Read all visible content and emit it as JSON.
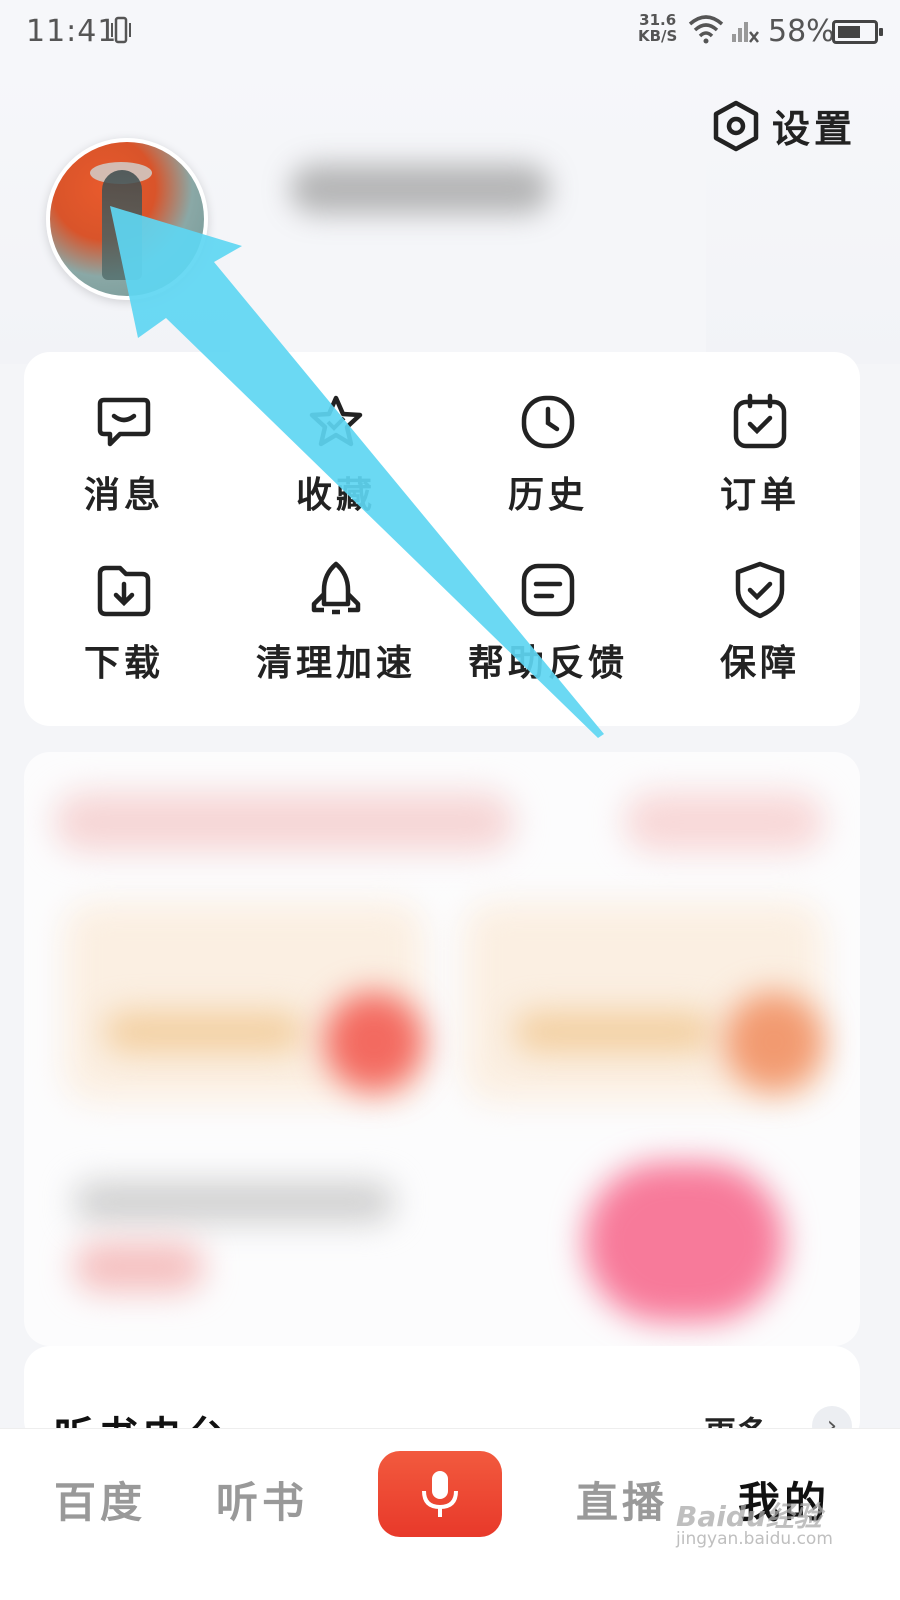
{
  "status_bar": {
    "time": "11:41",
    "net_speed_value": "31.6",
    "net_speed_unit": "KB/S",
    "battery_percent": "58%"
  },
  "header": {
    "settings_label": "设置",
    "avatar": "profile-avatar"
  },
  "menu": {
    "items": [
      {
        "label": "消息",
        "icon": "message-icon"
      },
      {
        "label": "收藏",
        "icon": "star-icon"
      },
      {
        "label": "历史",
        "icon": "clock-icon"
      },
      {
        "label": "订单",
        "icon": "calendar-check-icon"
      },
      {
        "label": "下载",
        "icon": "download-icon"
      },
      {
        "label": "清理加速",
        "icon": "rocket-icon"
      },
      {
        "label": "帮助反馈",
        "icon": "feedback-icon"
      },
      {
        "label": "保障",
        "icon": "shield-check-icon"
      }
    ]
  },
  "books": {
    "title": "听书电台",
    "more_label": "更多",
    "more_icon": "chevron-right-icon"
  },
  "tab_bar": {
    "tabs": [
      {
        "label": "百度"
      },
      {
        "label": "听书"
      },
      {
        "label": "直播"
      },
      {
        "label": "我的"
      }
    ],
    "center_icon": "microphone-icon",
    "accent": "#e8392a"
  },
  "watermark": {
    "line1": "Baidu经验",
    "line2": "jingyan.baidu.com"
  },
  "annotation_color": "#5ed6f2"
}
